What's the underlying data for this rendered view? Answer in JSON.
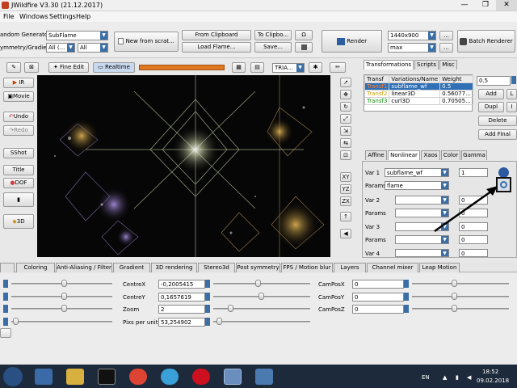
{
  "window": {
    "title": "JWildfire V3.30 (21.12.2017)",
    "min": "—",
    "max": "❐",
    "close": "✕"
  },
  "menu": [
    "File",
    "Windows",
    "Settings",
    "Help"
  ],
  "toolbar": {
    "random_generator_label": "andom Generator",
    "random_generator_value": "SubFlame",
    "symmetry_label": "ymmetry/Gradient",
    "symmetry_value": "All (...",
    "gradient_value": "All",
    "new_from_scratch": "New from scrat...",
    "from_clipboard": "From Clipboard",
    "to_clipboard": "To Clipbo...",
    "load_flame": "Load Flame...",
    "save": "Save...",
    "omega": "Ω",
    "render": "Render",
    "resolution": "1440x900",
    "quality": "max",
    "more1": "...",
    "more2": "...",
    "batch_renderer": "Batch Renderer"
  },
  "preview_toolbar": {
    "fine_edit": "Fine Edit",
    "realtime": "Realtime",
    "triangle_mode": "TRIA..."
  },
  "left_sidebar": {
    "ir": "IR",
    "movie": "Movie",
    "undo": "Undo",
    "redo": "Redo",
    "sshot": "SShot",
    "title": "Title",
    "dof": "DOF",
    "threed": "3D"
  },
  "axis_buttons": [
    "XY",
    "YZ",
    "ZX"
  ],
  "right_panel": {
    "tabs": [
      "Transformations",
      "Scripts",
      "Misc"
    ],
    "table_headers": [
      "Transf",
      "Variations/Name",
      "Weight"
    ],
    "table_rows": [
      {
        "transf": "Transf1",
        "variation": "subflame_wf",
        "weight": "0.5"
      },
      {
        "transf": "Transf2",
        "variation": "linear3D",
        "weight": "0.56077..."
      },
      {
        "transf": "Transf3",
        "variation": "curl3D",
        "weight": "0.70505..."
      }
    ],
    "weight_field": "0.5",
    "add": "Add",
    "l": "L",
    "dupl": "Dupl",
    "i": "I",
    "delete": "Delete",
    "add_final": "Add Final",
    "subtabs": [
      "Affine",
      "Nonlinear",
      "Xaos",
      "Color",
      "Gamma"
    ],
    "var_rows": [
      {
        "label": "Var 1",
        "variation": "subflame_wf",
        "value": "1"
      },
      {
        "label": "Params",
        "variation": "flame",
        "value": ""
      },
      {
        "label": "Var 2",
        "variation": "",
        "value": "0"
      },
      {
        "label": "Params",
        "variation": "",
        "value": "0"
      },
      {
        "label": "Var 3",
        "variation": "",
        "value": "0"
      },
      {
        "label": "Params",
        "variation": "",
        "value": "0"
      },
      {
        "label": "Var 4",
        "variation": "",
        "value": "0"
      }
    ]
  },
  "bottom_tabs": [
    "Coloring",
    "Anti-Aliasing / Filter",
    "Gradient",
    "3D rendering",
    "Stereo3d",
    "Post symmetry",
    "FPS / Motion blur",
    "Layers",
    "Channel mixer",
    "Leap Motion"
  ],
  "camera": {
    "centre_x_label": "CentreX",
    "centre_x": "-0,2005415",
    "centre_y_label": "CentreY",
    "centre_y": "0,1657619",
    "zoom_label": "Zoom",
    "zoom": "2",
    "pix_label": "Pixs per unit",
    "pix": "53,254902",
    "campos_x_label": "CamPosX",
    "campos_x": "0",
    "campos_y_label": "CamPosY",
    "campos_y": "0",
    "campos_z_label": "CamPosZ",
    "campos_z": "0"
  },
  "taskbar": {
    "lang": "EN",
    "time": "18:52",
    "date": "09.02.2018"
  },
  "colors": {
    "accent": "#3a6ea5",
    "transf1": "#e06000",
    "transf2": "#c8a000",
    "transf3": "#109010"
  }
}
